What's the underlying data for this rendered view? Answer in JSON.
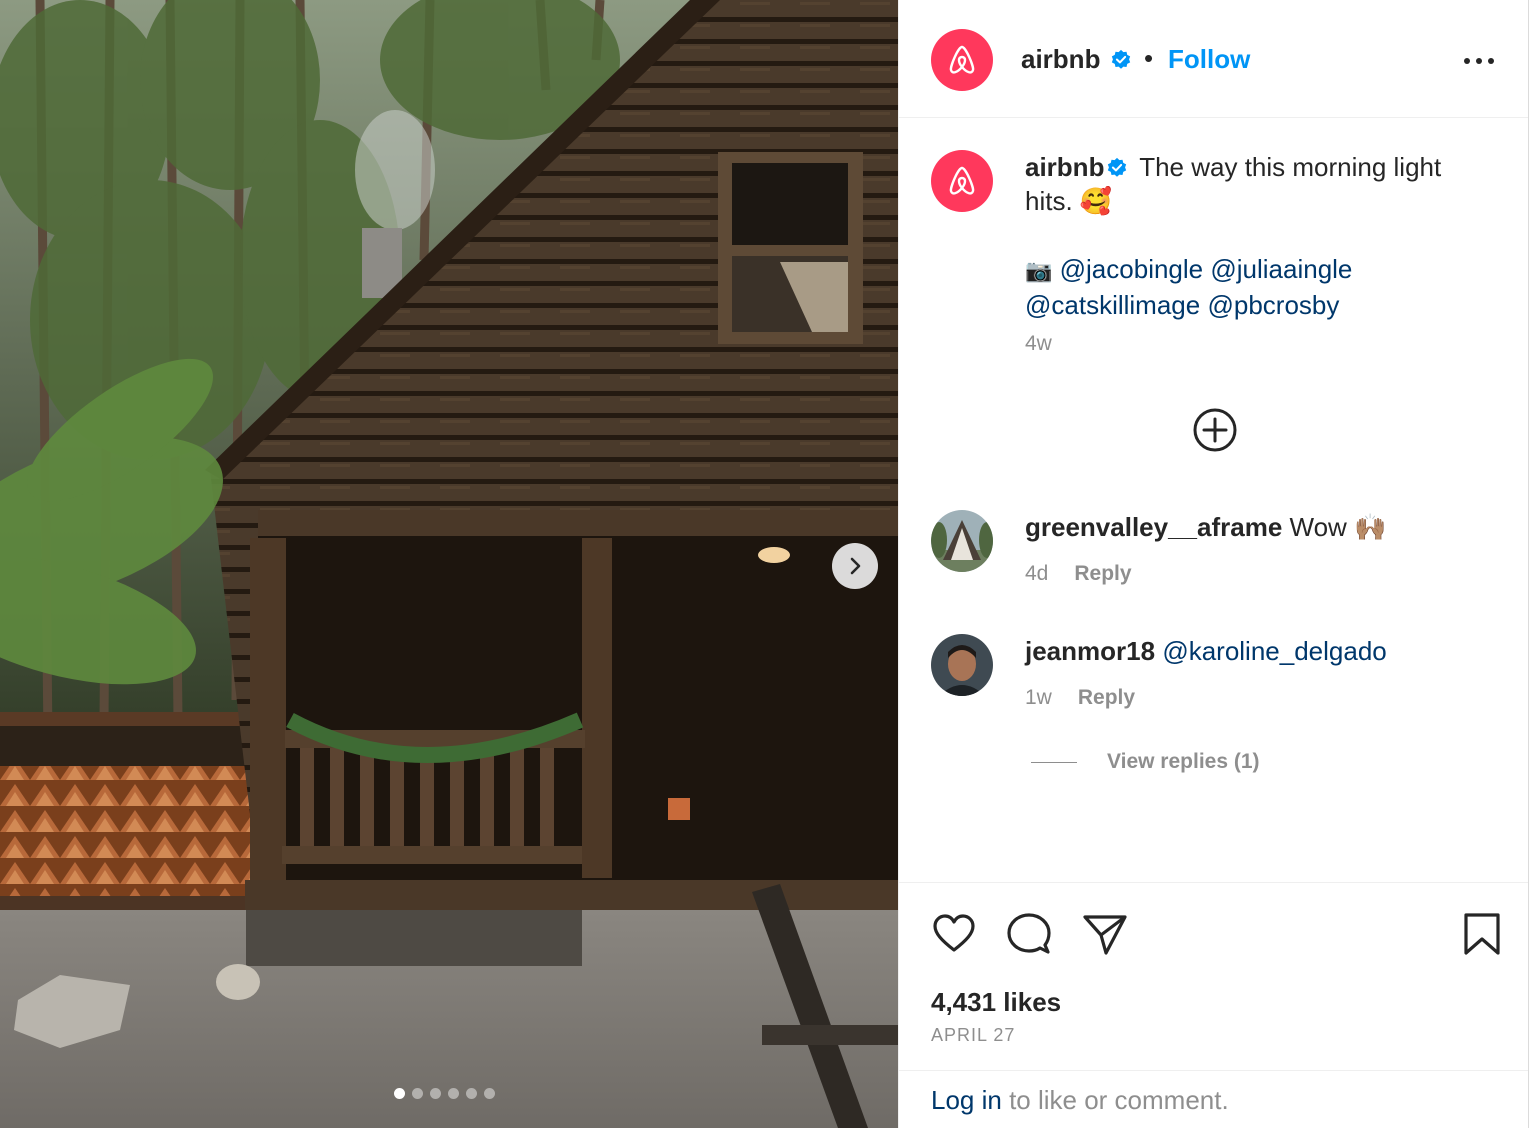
{
  "post": {
    "username": "airbnb",
    "separator": "•",
    "follow_label": "Follow",
    "carousel_total": 6,
    "carousel_active": 0
  },
  "caption": {
    "username": "airbnb",
    "text": " The way this morning light hits. 🥰",
    "camera_emoji": "📷",
    "mentions_line1": [
      "@jacobingle",
      "@juliaaingle"
    ],
    "mentions_line2": [
      "@catskillimage",
      "@pbcrosby"
    ],
    "time": "4w"
  },
  "comments": [
    {
      "username": "greenvalley__aframe",
      "text": " Wow 🙌🏽",
      "time": "4d",
      "reply_label": "Reply"
    },
    {
      "username": "jeanmor18",
      "mention": "@karoline_delgado",
      "time": "1w",
      "reply_label": "Reply"
    }
  ],
  "view_replies": "View replies (1)",
  "likes": "4,431 likes",
  "date": "APRIL 27",
  "login": {
    "link": "Log in",
    "rest": " to like or comment."
  },
  "colors": {
    "brand": "#ff385c",
    "follow": "#0095f6",
    "mention": "#00376b",
    "verified": "#0095f6"
  },
  "icons": [
    "airbnb-logo-icon",
    "verified-badge-icon",
    "more-options-icon",
    "plus-circle-icon",
    "heart-icon",
    "comment-icon",
    "share-icon",
    "bookmark-icon",
    "chevron-right-icon"
  ]
}
